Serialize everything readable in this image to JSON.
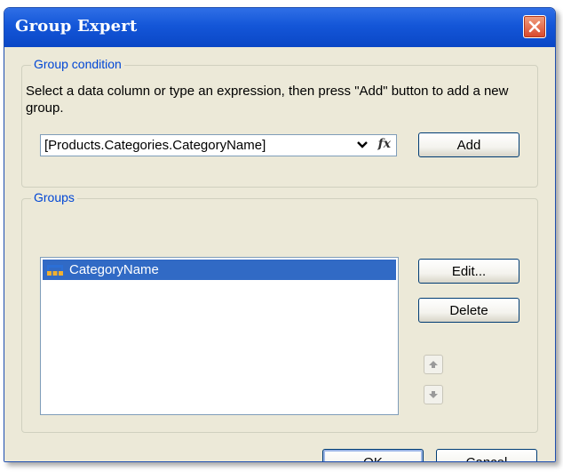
{
  "window": {
    "title": "Group Expert"
  },
  "group_condition": {
    "legend": "Group condition",
    "description": "Select a data column or type an expression, then press \"Add\" button to add a new group.",
    "expression_value": "[Products.Categories.CategoryName]",
    "add_label": "Add"
  },
  "groups": {
    "legend": "Groups",
    "items": [
      {
        "label": "CategoryName",
        "selected": true
      }
    ],
    "edit_label": "Edit...",
    "delete_label": "Delete"
  },
  "footer": {
    "ok_label": "OK",
    "cancel_label": "Cancel"
  },
  "colors": {
    "titlebar": "#0a47c6",
    "dialog_bg": "#ece9d8",
    "legend_text": "#0046d5",
    "selection": "#316ac5"
  },
  "icons": {
    "close": "close-icon",
    "dropdown": "chevron-down-icon",
    "expression": "fx-icon",
    "group_item": "group-icon",
    "move_up": "arrow-up-icon",
    "move_down": "arrow-down-icon"
  }
}
